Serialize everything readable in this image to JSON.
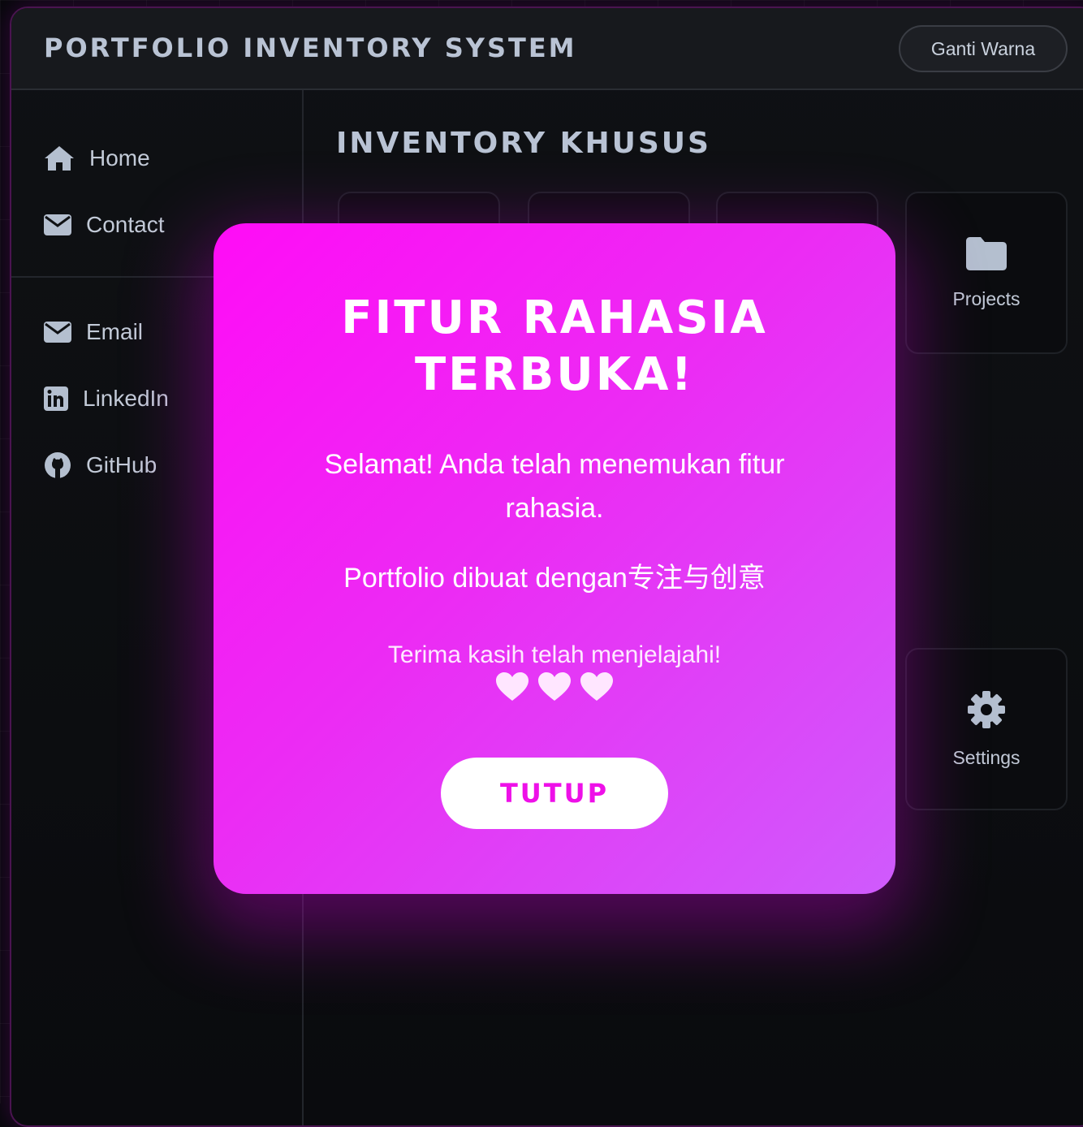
{
  "header": {
    "title": "PORTFOLIO INVENTORY SYSTEM",
    "theme_button_label": "Ganti Warna"
  },
  "sidebar": {
    "primary": [
      {
        "label": "Home",
        "icon": "home-icon"
      },
      {
        "label": "Contact",
        "icon": "envelope-icon"
      }
    ],
    "social": [
      {
        "label": "Email",
        "icon": "envelope-icon"
      },
      {
        "label": "LinkedIn",
        "icon": "linkedin-icon"
      },
      {
        "label": "GitHub",
        "icon": "github-icon"
      }
    ]
  },
  "main": {
    "section_title": "INVENTORY KHUSUS",
    "tiles": [
      {
        "label": "Projects",
        "icon": "folder-icon"
      },
      {
        "label": "Settings",
        "icon": "gear-icon"
      }
    ]
  },
  "modal": {
    "title_line1": "FITUR RAHASIA",
    "title_line2": "TERBUKA!",
    "message": "Selamat! Anda telah menemukan fitur rahasia.",
    "made_with": "Portfolio dibuat dengan专注与创意",
    "thanks": "Terima kasih telah menjelajahi!",
    "hearts": [
      "heart-icon",
      "heart-icon",
      "heart-icon"
    ],
    "close_label": "TUTUP"
  },
  "colors": {
    "modal_gradient_start": "#ff0cf6",
    "modal_gradient_end": "#cf5bfc",
    "page_background": "#07080b",
    "accent_text": "#ee10e8"
  }
}
